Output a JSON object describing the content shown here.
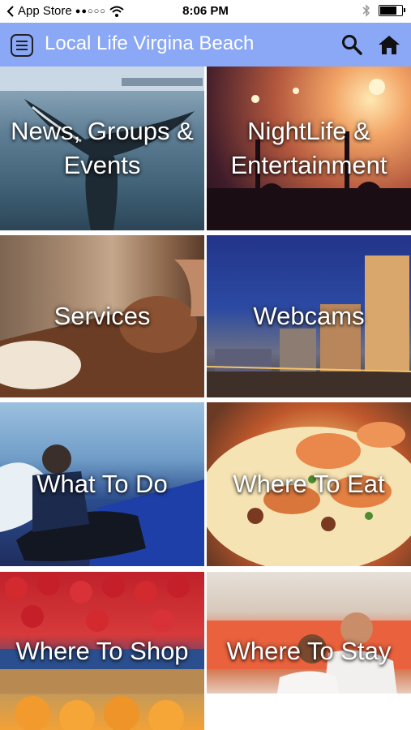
{
  "status_bar": {
    "carrier": "App Store",
    "signal": "●●○○○",
    "time": "8:06 PM",
    "bluetooth": "bluetooth-icon",
    "wifi": "wifi-icon",
    "battery_level": 0.85
  },
  "app_bar": {
    "title": "Local Life Virgina Beach",
    "background_color": "#8aa8f5",
    "menu_icon": "menu-icon",
    "search_icon": "search-icon",
    "home_icon": "home-icon"
  },
  "tiles": [
    {
      "label": "News, Groups & Events"
    },
    {
      "label": "NightLife & Entertainment"
    },
    {
      "label": "Services"
    },
    {
      "label": "Webcams"
    },
    {
      "label": "What To Do"
    },
    {
      "label": "Where To Eat"
    },
    {
      "label": "Where To Shop"
    },
    {
      "label": "Where To Stay"
    }
  ]
}
